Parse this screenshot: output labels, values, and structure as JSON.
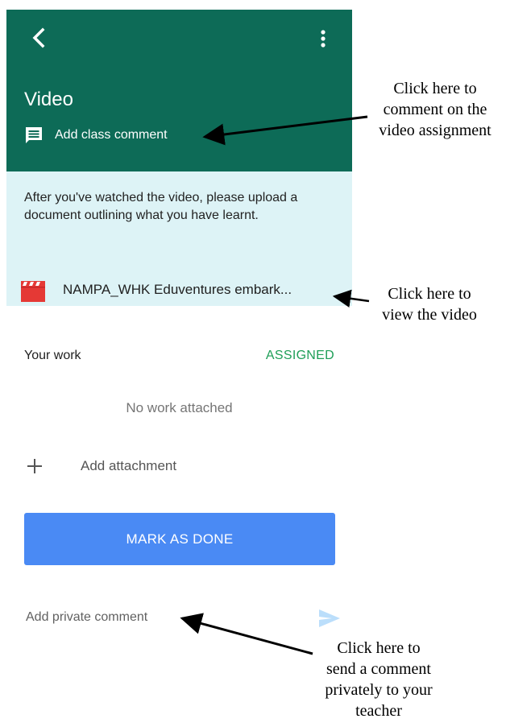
{
  "header": {
    "title": "Video",
    "class_comment_label": "Add class comment",
    "bg_color": "#0d6b57"
  },
  "description": {
    "text": "After you've watched the video, please upload a document outlining what you have learnt.",
    "bg_color": "#ddf3f6"
  },
  "attachment": {
    "icon": "video-clapper-icon",
    "name": "NAMPA_WHK Eduventures embark..."
  },
  "work": {
    "label": "Your work",
    "status": "ASSIGNED",
    "status_color": "#1e9e57",
    "empty_text": "No work attached",
    "add_attachment_label": "Add attachment",
    "mark_done_label": "MARK AS DONE",
    "mark_done_color": "#4a8af4"
  },
  "private_comment": {
    "placeholder": "Add private comment"
  },
  "annotations": {
    "class_comment": "Click here to\ncomment on the\nvideo assignment",
    "video": "Click here to\nview the video",
    "private_comment": "Click here to\nsend a comment\nprivately to your\nteacher"
  }
}
